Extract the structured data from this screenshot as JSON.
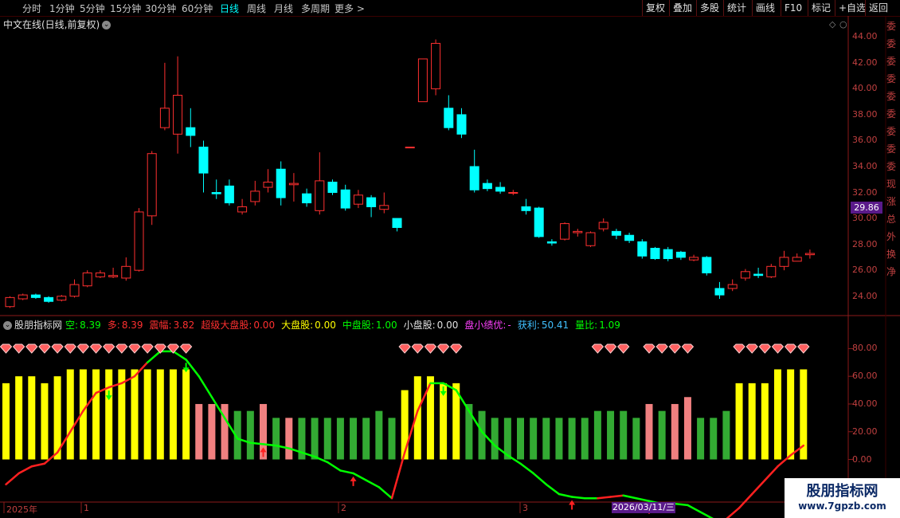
{
  "toolbar": {
    "periods": [
      "分时",
      "1分钟",
      "5分钟",
      "15分钟",
      "30分钟",
      "60分钟",
      "日线",
      "周线",
      "月线",
      "多周期",
      "更多 >"
    ],
    "active": "日线",
    "right_buttons": [
      "复权",
      "叠加",
      "多股",
      "统计",
      "画线",
      "F10",
      "标记",
      "+自选",
      "返回"
    ]
  },
  "main": {
    "title": "中文在线(日线,前复权)",
    "price_axis": [
      "44.00",
      "42.00",
      "40.00",
      "38.00",
      "36.00",
      "34.00",
      "32.00",
      "30.00",
      "28.00",
      "26.00",
      "24.00"
    ],
    "current_price": "29.86"
  },
  "indicator": {
    "name": "股朋指标网",
    "items": [
      {
        "label": "空:",
        "value": "8.39",
        "color": "#00ff00"
      },
      {
        "label": "多:",
        "value": "8.39",
        "color": "#ff3030"
      },
      {
        "label": "震幅:",
        "value": "3.82",
        "color": "#ff3030"
      },
      {
        "label": "超级大盘股:",
        "value": "0.00",
        "color": "#ff3030"
      },
      {
        "label": "大盘股:",
        "value": "0.00",
        "color": "#ffff00"
      },
      {
        "label": "中盘股:",
        "value": "1.00",
        "color": "#00ff00"
      },
      {
        "label": "小盘股:",
        "value": "0.00",
        "color": "#e0e0e0"
      },
      {
        "label": "盘小绩优:",
        "value": "-",
        "color": "#ff40ff"
      },
      {
        "label": "获利:",
        "value": "50.41",
        "color": "#40c0ff"
      },
      {
        "label": "量比:",
        "value": "1.09",
        "color": "#00ff00"
      }
    ],
    "axis": [
      "80.00",
      "60.00",
      "40.00",
      "20.00",
      "0.00",
      "-20.00"
    ]
  },
  "date_axis": [
    "2025年",
    "1",
    "2",
    "3"
  ],
  "date_badge": "2026/03/11/三",
  "watermark": {
    "title": "股朋指标网",
    "url": "www.7gpzb.com"
  },
  "side_text": [
    "委",
    "委",
    "委",
    "委",
    "委",
    "委",
    "委",
    "委",
    "委",
    "现",
    "涨",
    "总",
    "外",
    "换",
    "净"
  ],
  "colors": {
    "up": "#ff3030",
    "down": "#00ffff",
    "bull": "#ffff00",
    "bear": "#33aa33",
    "weak": "#f08080",
    "trend_up": "#ff2020",
    "trend_down": "#00ff00"
  },
  "chart_data": {
    "type": "candlestick",
    "candles": [
      [
        23.2,
        23.9,
        24.0,
        23.1
      ],
      [
        23.8,
        24.1,
        24.2,
        23.7
      ],
      [
        24.1,
        23.9,
        24.2,
        23.8
      ],
      [
        23.9,
        23.6,
        24.0,
        23.5
      ],
      [
        23.7,
        24.0,
        24.1,
        23.6
      ],
      [
        24.0,
        24.9,
        25.3,
        23.9
      ],
      [
        24.8,
        25.8,
        26.0,
        24.7
      ],
      [
        25.5,
        25.8,
        26.0,
        25.4
      ],
      [
        25.5,
        25.6,
        26.2,
        25.4
      ],
      [
        25.4,
        26.3,
        27.0,
        25.2
      ],
      [
        26.0,
        30.5,
        30.8,
        25.9
      ],
      [
        30.2,
        35.0,
        35.2,
        29.5
      ],
      [
        37.0,
        38.5,
        42.0,
        36.8
      ],
      [
        36.5,
        39.5,
        42.5,
        35.0
      ],
      [
        37.0,
        36.4,
        38.5,
        35.5
      ],
      [
        35.5,
        33.5,
        36.0,
        32.0
      ],
      [
        32.0,
        31.9,
        33.0,
        31.5
      ],
      [
        32.5,
        31.2,
        33.0,
        31.0
      ],
      [
        30.5,
        30.9,
        31.5,
        30.3
      ],
      [
        31.3,
        32.1,
        32.9,
        31.0
      ],
      [
        32.4,
        32.8,
        33.8,
        32.0
      ],
      [
        33.8,
        31.6,
        34.4,
        31.0
      ],
      [
        32.6,
        32.7,
        33.5,
        31.3
      ],
      [
        31.9,
        31.2,
        32.3,
        30.9
      ],
      [
        30.6,
        32.9,
        35.1,
        30.3
      ],
      [
        32.8,
        32.0,
        33.0,
        31.8
      ],
      [
        32.2,
        30.8,
        32.6,
        30.6
      ],
      [
        31.1,
        31.8,
        32.2,
        30.8
      ],
      [
        31.6,
        30.9,
        31.8,
        30.1
      ],
      [
        30.7,
        31.0,
        32.0,
        30.4
      ],
      [
        30.0,
        29.3,
        30.0,
        29.0
      ],
      [
        35.5,
        35.5,
        35.5,
        35.5
      ],
      [
        39.0,
        42.3,
        42.3,
        39.0
      ],
      [
        40.0,
        43.5,
        43.8,
        39.5
      ],
      [
        38.5,
        37.0,
        39.5,
        36.8
      ],
      [
        38.0,
        36.5,
        38.5,
        36.2
      ],
      [
        34.0,
        32.2,
        35.3,
        32.0
      ],
      [
        32.7,
        32.3,
        33.0,
        32.1
      ],
      [
        32.4,
        32.1,
        32.8,
        31.9
      ],
      [
        32.0,
        32.0,
        32.2,
        31.8
      ],
      [
        30.9,
        30.6,
        31.5,
        30.3
      ],
      [
        30.8,
        28.6,
        30.9,
        28.5
      ],
      [
        28.2,
        28.1,
        28.4,
        27.9
      ],
      [
        28.4,
        29.6,
        29.7,
        28.3
      ],
      [
        28.9,
        29.0,
        29.2,
        28.6
      ],
      [
        27.9,
        28.9,
        29.0,
        27.8
      ],
      [
        29.2,
        29.7,
        30.0,
        29.0
      ],
      [
        29.0,
        28.7,
        29.2,
        28.4
      ],
      [
        28.7,
        28.3,
        28.9,
        28.1
      ],
      [
        28.2,
        27.1,
        28.4,
        26.9
      ],
      [
        27.7,
        26.9,
        27.8,
        26.8
      ],
      [
        27.6,
        26.9,
        27.8,
        26.7
      ],
      [
        27.4,
        27.0,
        27.5,
        26.8
      ],
      [
        26.8,
        27.0,
        27.2,
        26.7
      ],
      [
        27.0,
        25.8,
        27.1,
        25.6
      ],
      [
        24.6,
        24.1,
        25.1,
        23.8
      ],
      [
        24.6,
        24.9,
        25.3,
        24.4
      ],
      [
        25.4,
        25.9,
        26.1,
        25.2
      ],
      [
        25.7,
        25.6,
        26.2,
        25.4
      ],
      [
        25.5,
        26.3,
        26.5,
        25.4
      ],
      [
        26.3,
        27.0,
        27.5,
        26.0
      ],
      [
        26.7,
        27.0,
        27.3,
        26.7
      ],
      [
        27.2,
        27.3,
        27.6,
        26.9
      ]
    ],
    "bars": [
      [
        "bull",
        55
      ],
      [
        "bull",
        60
      ],
      [
        "bull",
        60
      ],
      [
        "bull",
        55
      ],
      [
        "bull",
        60
      ],
      [
        "bull",
        65
      ],
      [
        "bull",
        65
      ],
      [
        "bull",
        65
      ],
      [
        "bull",
        65
      ],
      [
        "bull",
        65
      ],
      [
        "bull",
        65
      ],
      [
        "bull",
        65
      ],
      [
        "bull",
        65
      ],
      [
        "bull",
        65
      ],
      [
        "bull",
        65
      ],
      [
        "weak",
        40
      ],
      [
        "weak",
        40
      ],
      [
        "weak",
        40
      ],
      [
        "bear",
        35
      ],
      [
        "bear",
        35
      ],
      [
        "weak",
        40
      ],
      [
        "bear",
        30
      ],
      [
        "weak",
        30
      ],
      [
        "bear",
        30
      ],
      [
        "bear",
        30
      ],
      [
        "bear",
        30
      ],
      [
        "bear",
        30
      ],
      [
        "bear",
        30
      ],
      [
        "bear",
        30
      ],
      [
        "bear",
        35
      ],
      [
        "bear",
        30
      ],
      [
        "bull",
        50
      ],
      [
        "bull",
        60
      ],
      [
        "bull",
        60
      ],
      [
        "bull",
        55
      ],
      [
        "bull",
        55
      ],
      [
        "bear",
        40
      ],
      [
        "bear",
        35
      ],
      [
        "bear",
        30
      ],
      [
        "bear",
        30
      ],
      [
        "bear",
        30
      ],
      [
        "bear",
        30
      ],
      [
        "bear",
        30
      ],
      [
        "bear",
        30
      ],
      [
        "bear",
        30
      ],
      [
        "bear",
        30
      ],
      [
        "bear",
        35
      ],
      [
        "bear",
        35
      ],
      [
        "bear",
        35
      ],
      [
        "bear",
        30
      ],
      [
        "weak",
        40
      ],
      [
        "bear",
        35
      ],
      [
        "weak",
        40
      ],
      [
        "weak",
        45
      ],
      [
        "bear",
        30
      ],
      [
        "bear",
        30
      ],
      [
        "bear",
        35
      ],
      [
        "bull",
        55
      ],
      [
        "bull",
        55
      ],
      [
        "bull",
        55
      ],
      [
        "bull",
        65
      ],
      [
        "bull",
        65
      ],
      [
        "bull",
        65
      ]
    ],
    "trend": [
      -18,
      -10,
      -5,
      -3,
      5,
      20,
      35,
      48,
      52,
      55,
      60,
      70,
      78,
      78,
      72,
      60,
      45,
      30,
      15,
      12,
      11,
      10,
      8,
      5,
      2,
      -2,
      -8,
      -10,
      -15,
      -20,
      -28,
      5,
      35,
      55,
      55,
      50,
      35,
      20,
      10,
      3,
      -3,
      -10,
      -18,
      -25,
      -27,
      -28,
      -28,
      -27,
      -26,
      -28,
      -30,
      -32,
      -32,
      -33,
      -38,
      -43,
      -43,
      -35,
      -25,
      -15,
      -5,
      3,
      10
    ],
    "trend_up": [
      true,
      true,
      true,
      true,
      true,
      true,
      true,
      true,
      true,
      true,
      true,
      true,
      false,
      false,
      false,
      false,
      false,
      false,
      false,
      false,
      false,
      false,
      false,
      false,
      false,
      false,
      false,
      false,
      false,
      false,
      false,
      true,
      true,
      true,
      false,
      false,
      false,
      false,
      false,
      false,
      false,
      false,
      false,
      false,
      false,
      false,
      false,
      true,
      true,
      false,
      false,
      false,
      false,
      false,
      false,
      false,
      false,
      true,
      true,
      true,
      true,
      true,
      true
    ],
    "gems": [
      0,
      1,
      2,
      3,
      4,
      5,
      6,
      7,
      8,
      9,
      10,
      11,
      12,
      13,
      14,
      31,
      32,
      33,
      34,
      35,
      46,
      47,
      48,
      50,
      51,
      52,
      53,
      57,
      58,
      59,
      60,
      61,
      62
    ],
    "buy_arrows": [
      20,
      27,
      44,
      50
    ],
    "sell_arrows": [
      8,
      14,
      34
    ],
    "price_range": [
      23,
      45
    ],
    "osc_range": [
      -25,
      90
    ]
  }
}
